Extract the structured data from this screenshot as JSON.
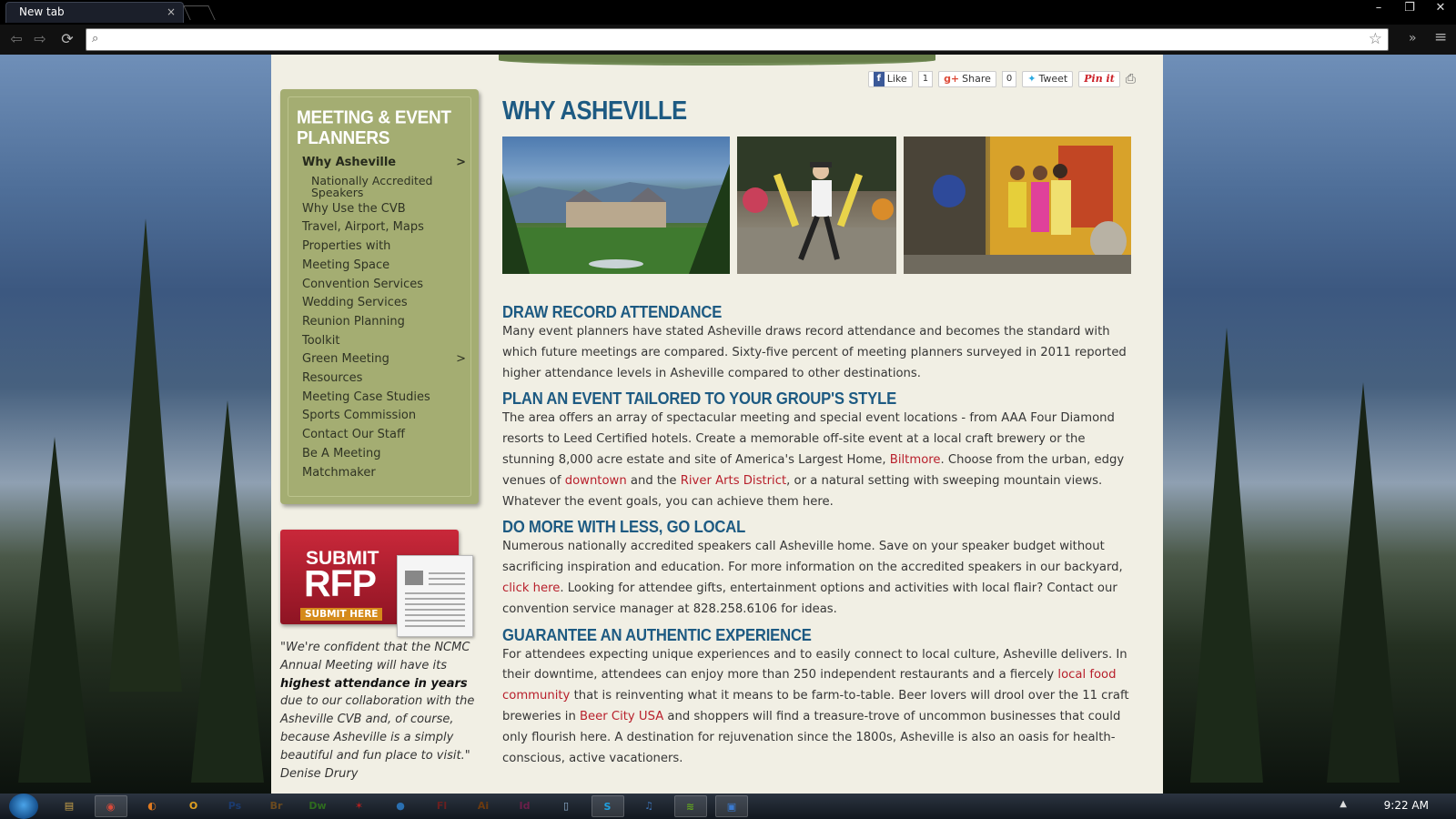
{
  "browser": {
    "tab_title": "New tab",
    "tab_close": "×",
    "win_min": "–",
    "win_max": "❐",
    "win_close": "✕",
    "omnibox_value": "",
    "nav_back": "⇦",
    "nav_forward": "⇨",
    "nav_reload": "⟳",
    "star": "☆",
    "overflow": "»",
    "menu": "≡"
  },
  "share": {
    "like_label": "Like",
    "like_count": "1",
    "share_label": "Share",
    "share_count": "0",
    "tweet_label": "Tweet",
    "pin_label": "Pin it"
  },
  "sidebar": {
    "title": "MEETING & EVENT PLANNERS",
    "items": [
      {
        "label": "Why Asheville",
        "active": true,
        "arrow": ">"
      },
      {
        "label": "Nationally Accredited Speakers",
        "sub": true
      },
      {
        "label": "Why Use the CVB"
      },
      {
        "label": "Travel, Airport, Maps"
      },
      {
        "label": "Properties with"
      },
      {
        "label": "Meeting Space"
      },
      {
        "label": "Convention Services"
      },
      {
        "label": "Wedding Services"
      },
      {
        "label": "Reunion Planning"
      },
      {
        "label": "Toolkit"
      },
      {
        "label": "Green Meeting",
        "arrow": ">"
      },
      {
        "label": "Resources"
      },
      {
        "label": "Meeting Case Studies"
      },
      {
        "label": "Sports Commission"
      },
      {
        "label": "Contact Our Staff"
      },
      {
        "label": "Be A Meeting"
      },
      {
        "label": "Matchmaker"
      }
    ]
  },
  "rfp": {
    "submit": "SUBMIT",
    "rfp": "RFP",
    "here": "SUBMIT HERE"
  },
  "quote": {
    "part1": "\"We're confident that the NCMC Annual Meeting will have its ",
    "bold": "highest attendance in years",
    "part2": " due to our collaboration with the Asheville CVB and, of course, because Asheville is a simply beautiful and fun place to visit.\"",
    "author": "Denise Drury"
  },
  "main": {
    "title": "WHY ASHEVILLE",
    "sections": [
      {
        "heading": "DRAW RECORD ATTENDANCE",
        "parts": [
          {
            "t": "Many event planners have stated Asheville draws record attendance and becomes the standard with which future meetings are compared. Sixty-five percent of meeting planners surveyed in 2011 reported higher attendance levels in Asheville compared to other destinations."
          }
        ]
      },
      {
        "heading": "PLAN AN EVENT TAILORED TO YOUR GROUP'S STYLE",
        "parts": [
          {
            "t": "The area offers an array of spectacular meeting and special event locations - from AAA Four Diamond resorts to Leed Certified hotels. Create a memorable off-site event at a local craft brewery or the stunning 8,000 acre estate and site of America's Largest Home, "
          },
          {
            "t": "Biltmore",
            "link": true
          },
          {
            "t": ". Choose from the urban, edgy venues of "
          },
          {
            "t": "downtown",
            "link": true
          },
          {
            "t": " and the "
          },
          {
            "t": "River Arts District",
            "link": true
          },
          {
            "t": ", or a natural setting with sweeping mountain views. Whatever the event goals, you can achieve them here."
          }
        ]
      },
      {
        "heading": "DO MORE WITH LESS, GO LOCAL",
        "parts": [
          {
            "t": "Numerous nationally accredited speakers call Asheville home. Save on your speaker budget without sacrificing inspiration and education. For more information on the accredited speakers in our backyard, "
          },
          {
            "t": "click here",
            "link": true
          },
          {
            "t": ". Looking for attendee gifts, entertainment options and activities with local flair? Contact our convention service manager at 828.258.6106 for ideas."
          }
        ]
      },
      {
        "heading": "GUARANTEE AN AUTHENTIC EXPERIENCE",
        "parts": [
          {
            "t": "For attendees expecting unique experiences and to easily connect to local culture, Asheville delivers. In their downtime, attendees can enjoy more than 250 independent restaurants and a fiercely "
          },
          {
            "t": "local food community",
            "link": true
          },
          {
            "t": " that is reinventing what it means to be farm-to-table. Beer lovers will drool over the 11 craft breweries in "
          },
          {
            "t": "Beer City USA",
            "link": true
          },
          {
            "t": " and shoppers will find a treasure-trove of uncommon businesses that could only flourish here. A destination for rejuvenation since the 1800s, Asheville is also an oasis for health-conscious, active vacationers."
          }
        ]
      }
    ]
  },
  "taskbar": {
    "clock": "9:22 AM",
    "tray_arrow": "▲",
    "apps": [
      {
        "name": "explorer-icon",
        "glyph": "▤",
        "color": "#c8a24a"
      },
      {
        "name": "chrome-icon",
        "glyph": "◉",
        "color": "#d94a3a",
        "pinned": true
      },
      {
        "name": "firefox-icon",
        "glyph": "◐",
        "color": "#e07a1f"
      },
      {
        "name": "outlook-icon",
        "glyph": "O",
        "color": "#e0a020"
      },
      {
        "name": "photoshop-icon",
        "glyph": "Ps",
        "color": "#1b3b6f"
      },
      {
        "name": "bridge-icon",
        "glyph": "Br",
        "color": "#6b4a1f"
      },
      {
        "name": "dreamweaver-icon",
        "glyph": "Dw",
        "color": "#2e6b1f"
      },
      {
        "name": "acrobat-icon",
        "glyph": "✶",
        "color": "#b02020"
      },
      {
        "name": "app-round-icon",
        "glyph": "●",
        "color": "#2a6fb0"
      },
      {
        "name": "flash-icon",
        "glyph": "Fl",
        "color": "#6b1f1f"
      },
      {
        "name": "illustrator-icon",
        "glyph": "Ai",
        "color": "#6b3a0f"
      },
      {
        "name": "indesign-icon",
        "glyph": "Id",
        "color": "#6b1f4a"
      },
      {
        "name": "notes-icon",
        "glyph": "▯",
        "color": "#8fb0d0"
      },
      {
        "name": "skype-icon",
        "glyph": "S",
        "color": "#1fa0e0",
        "pinned": true
      },
      {
        "name": "itunes-icon",
        "glyph": "♫",
        "color": "#3a6fb0"
      },
      {
        "name": "spotify-icon",
        "glyph": "≋",
        "color": "#5fa020",
        "pinned": true
      },
      {
        "name": "window-app-icon",
        "glyph": "▣",
        "color": "#3a7ad0",
        "pinned": true
      }
    ]
  }
}
